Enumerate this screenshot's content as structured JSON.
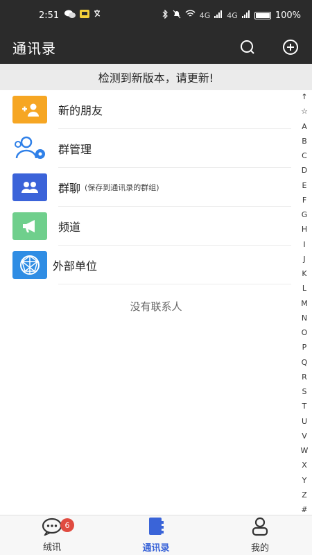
{
  "status_bar": {
    "time": "2:51",
    "left_icons": [
      "wechat-icon",
      "app-icon",
      "translate-icon"
    ],
    "network_4g_1": "4G",
    "network_4g_2": "4G",
    "battery": "100%"
  },
  "header": {
    "title": "通讯录",
    "search_icon": "search-icon",
    "add_icon": "plus-circle-icon"
  },
  "banner": {
    "text": "检测到新版本，请更新!"
  },
  "list": {
    "items": [
      {
        "label": "新的朋友",
        "sub": "",
        "icon": "add-friend-icon",
        "color": "#f6a623"
      },
      {
        "label": "群管理",
        "sub": "",
        "icon": "group-settings-icon",
        "color": "#2f80e8"
      },
      {
        "label": "群聊",
        "sub": "(保存到通讯录的群组)",
        "icon": "group-chat-icon",
        "color": "#3b63d9"
      },
      {
        "label": "频道",
        "sub": "",
        "icon": "megaphone-icon",
        "color": "#6fcf8c"
      },
      {
        "label": "外部单位",
        "sub": "",
        "icon": "globe-network-icon",
        "color": "#2f8de4"
      }
    ]
  },
  "empty_text": "没有联系人",
  "index_bar": [
    "↑",
    "☆",
    "A",
    "B",
    "C",
    "D",
    "E",
    "F",
    "G",
    "H",
    "I",
    "J",
    "K",
    "L",
    "M",
    "N",
    "O",
    "P",
    "Q",
    "R",
    "S",
    "T",
    "U",
    "V",
    "W",
    "X",
    "Y",
    "Z",
    "#"
  ],
  "tabs": [
    {
      "label": "绒讯",
      "icon": "chat-bubble-icon",
      "badge": "6",
      "active": false
    },
    {
      "label": "通讯录",
      "icon": "contacts-book-icon",
      "badge": "",
      "active": true
    },
    {
      "label": "我的",
      "icon": "person-icon",
      "badge": "",
      "active": false
    }
  ],
  "colors": {
    "header_bg": "#2b2b2b",
    "accent": "#3a64d8",
    "badge": "#e04b40"
  }
}
